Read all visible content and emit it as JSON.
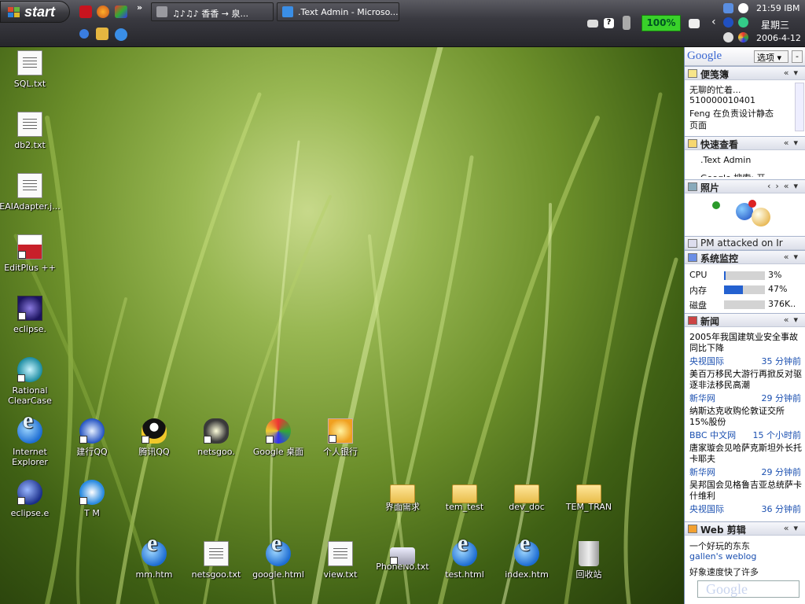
{
  "taskbar": {
    "start_label": "start",
    "buttons": [
      {
        "label": "♫♪♫♪ 香香 → 泉..."
      },
      {
        "label": ".Text Admin - Microso..."
      }
    ],
    "chevron": "»",
    "battery": "100%",
    "clock": {
      "time": "21:59 IBM",
      "weekday": "星期三",
      "date": "2006-4-12"
    },
    "tray_back": "‹"
  },
  "desktop": {
    "icons": [
      {
        "label": "SQL.txt",
        "kind": "doc"
      },
      {
        "label": "db2.txt",
        "kind": "doc"
      },
      {
        "label": "EAIAdapter.j...",
        "kind": "doc"
      },
      {
        "label": "EditPlus ++",
        "kind": "app"
      },
      {
        "label": "eclipse.",
        "kind": "app"
      },
      {
        "label": "Rational ClearCase",
        "kind": "app"
      },
      {
        "label": "Internet Explorer",
        "kind": "ie"
      },
      {
        "label": "建行QQ",
        "kind": "app"
      },
      {
        "label": "腾讯QQ",
        "kind": "app"
      },
      {
        "label": "netsgoo.",
        "kind": "app"
      },
      {
        "label": "Google 桌面",
        "kind": "app"
      },
      {
        "label": "个人银行",
        "kind": "app"
      },
      {
        "label": "eclipse.e",
        "kind": "app"
      },
      {
        "label": "T M",
        "kind": "app"
      },
      {
        "label": "界面需求",
        "kind": "folder"
      },
      {
        "label": "tem_test",
        "kind": "folder"
      },
      {
        "label": "dev_doc",
        "kind": "folder"
      },
      {
        "label": "TEM_TRAN",
        "kind": "folder"
      },
      {
        "label": "mm.htm",
        "kind": "ie"
      },
      {
        "label": "netsgoo.txt",
        "kind": "doc"
      },
      {
        "label": "google.html",
        "kind": "ie"
      },
      {
        "label": "view.txt",
        "kind": "doc"
      },
      {
        "label": "PhoneNo.txt",
        "kind": "app"
      },
      {
        "label": "test.html",
        "kind": "ie"
      },
      {
        "label": "index.htm",
        "kind": "ie"
      },
      {
        "label": "回收站",
        "kind": "bin"
      }
    ]
  },
  "sidebar": {
    "logo": "Google",
    "options_label": "选项 ▾",
    "min_label": "-",
    "notes": {
      "title": "便笺簿",
      "lines": [
        "无聊的忙着...",
        "510000010401",
        "Feng 在负责设计静态",
        "页面"
      ]
    },
    "quick": {
      "title": "快速查看",
      "items": [
        ".Text Admin",
        "Google 搜索: 开..."
      ]
    },
    "photos": {
      "title": "照片"
    },
    "pm": {
      "title": "PM attacked on Ir"
    },
    "monitor": {
      "title": "系统监控",
      "rows": [
        {
          "label": "CPU",
          "value": "3%",
          "fill": 0.03
        },
        {
          "label": "内存",
          "value": "47%",
          "fill": 0.47
        },
        {
          "label": "磁盘",
          "value": "376K..",
          "fill": 0
        }
      ]
    },
    "news": {
      "title": "新闻",
      "items": [
        {
          "headline": "2005年我国建筑业安全事故同比下降",
          "source": "央视国际",
          "time": "35 分钟前"
        },
        {
          "headline": "美百万移民大游行再掀反对驱逐非法移民高潮",
          "source": "新华网",
          "time": "29 分钟前"
        },
        {
          "headline": "纳斯达克收购伦敦证交所15%股份",
          "source": "BBC 中文网",
          "time": "15 个小时前"
        },
        {
          "headline": "唐家璇会见哈萨克斯坦外长托卡耶夫",
          "source": "新华网",
          "time": "29 分钟前"
        },
        {
          "headline": "吴邦国会见格鲁吉亚总统萨卡什维利",
          "source": "央视国际",
          "time": "36 分钟前"
        }
      ]
    },
    "clips": {
      "title": "Web 剪辑",
      "items": [
        "一个好玩的东东",
        "gallen's weblog",
        "好象速度快了许多"
      ]
    },
    "search_logo": "Google"
  },
  "colors": {
    "taskbar": "#2f2f35",
    "battery": "#39d12a",
    "link": "#1a4fb0",
    "bar": "#2461d0"
  }
}
